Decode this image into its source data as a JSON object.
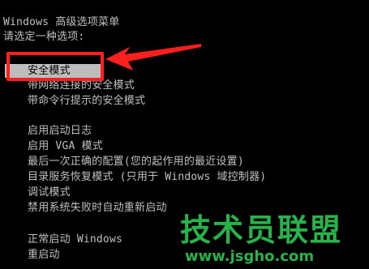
{
  "header": {
    "title": "Windows 高级选项菜单",
    "prompt": "请选定一种选项:"
  },
  "menu": {
    "items": [
      {
        "label": "安全模式",
        "selected": true
      },
      {
        "label": "带网络连接的安全模式",
        "selected": false
      },
      {
        "label": "带命令行提示的安全模式",
        "selected": false
      },
      {
        "label": "启用启动日志",
        "selected": false
      },
      {
        "label": "启用 VGA 模式",
        "selected": false
      },
      {
        "label": "最后一次正确的配置(您的起作用的最近设置)",
        "selected": false
      },
      {
        "label": "目录服务恢复模式 (只用于 Windows 域控制器)",
        "selected": false
      },
      {
        "label": "调试模式",
        "selected": false
      },
      {
        "label": "禁用系统失败时自动重新启动",
        "selected": false
      },
      {
        "label": "正常启动 Windows",
        "selected": false
      },
      {
        "label": "重启动",
        "selected": false
      }
    ]
  },
  "annotation": {
    "color": "#ff1f1f"
  },
  "watermark": {
    "title": "技术员联盟",
    "url": "www.jsgho.com",
    "color": "#27b34a"
  }
}
